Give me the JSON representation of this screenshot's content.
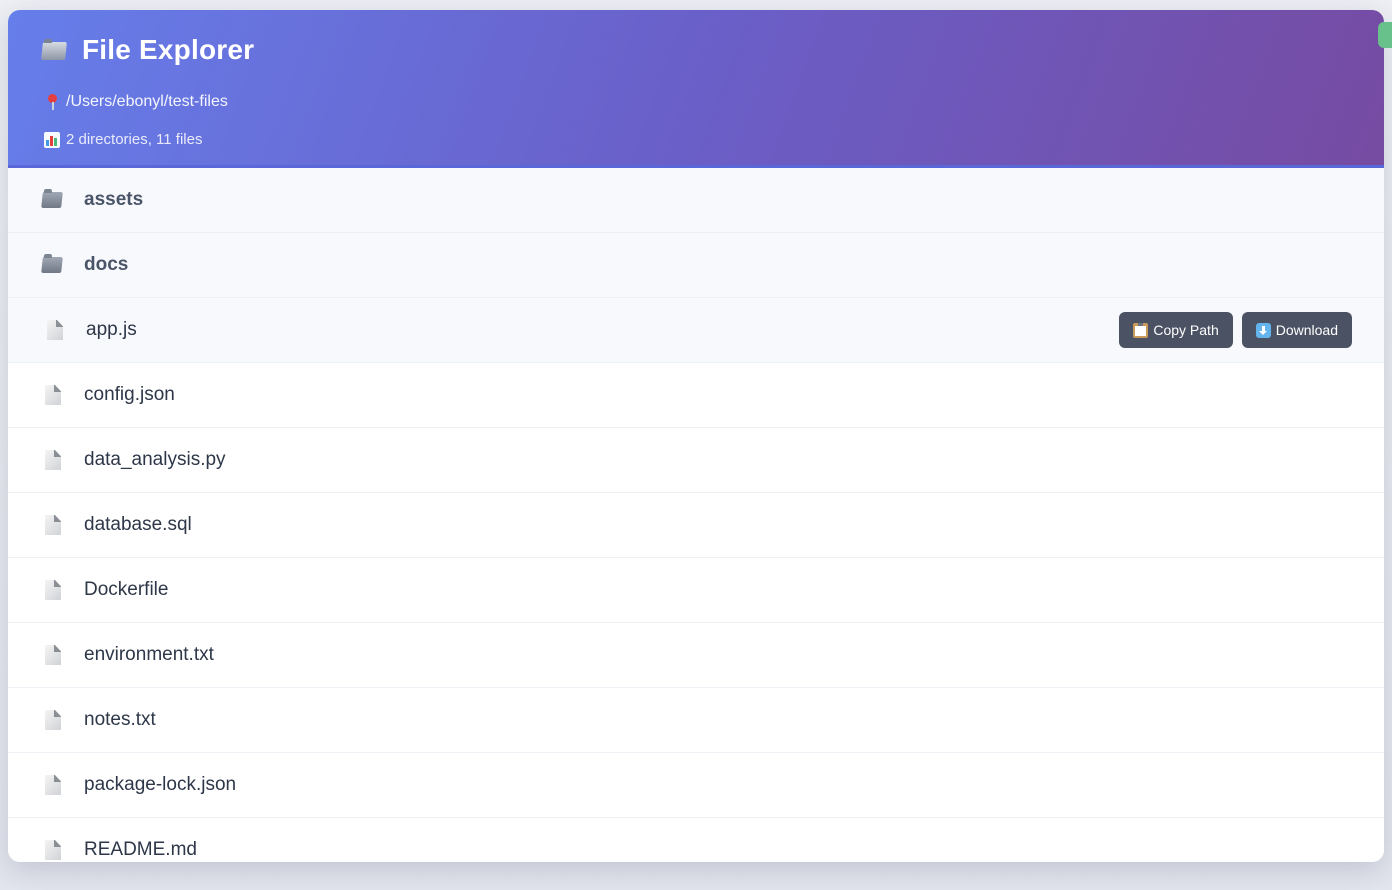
{
  "header": {
    "title": "File Explorer",
    "path": "/Users/ebonyl/test-files",
    "stats": "2 directories, 11 files",
    "title_icon": "folder-icon",
    "path_icon": "pin-icon",
    "stats_icon": "bar-chart-icon"
  },
  "colors": {
    "header_gradient_start": "#667eea",
    "header_gradient_end": "#764ba2",
    "button_bg": "#4a5263",
    "status_indicator": "#68c08a"
  },
  "entries": [
    {
      "name": "assets",
      "type": "directory",
      "icon": "folder-icon"
    },
    {
      "name": "docs",
      "type": "directory",
      "icon": "folder-icon"
    },
    {
      "name": "app.js",
      "type": "file",
      "icon": "file-icon"
    },
    {
      "name": "config.json",
      "type": "file",
      "icon": "file-icon"
    },
    {
      "name": "data_analysis.py",
      "type": "file",
      "icon": "file-icon"
    },
    {
      "name": "database.sql",
      "type": "file",
      "icon": "file-icon"
    },
    {
      "name": "Dockerfile",
      "type": "file",
      "icon": "file-icon"
    },
    {
      "name": "environment.txt",
      "type": "file",
      "icon": "file-icon"
    },
    {
      "name": "notes.txt",
      "type": "file",
      "icon": "file-icon"
    },
    {
      "name": "package-lock.json",
      "type": "file",
      "icon": "file-icon"
    },
    {
      "name": "README.md",
      "type": "file",
      "icon": "file-icon"
    }
  ],
  "actions": {
    "copy_path_label": "Copy Path",
    "copy_path_icon": "clipboard-icon",
    "download_label": "Download",
    "download_icon": "download-icon"
  }
}
